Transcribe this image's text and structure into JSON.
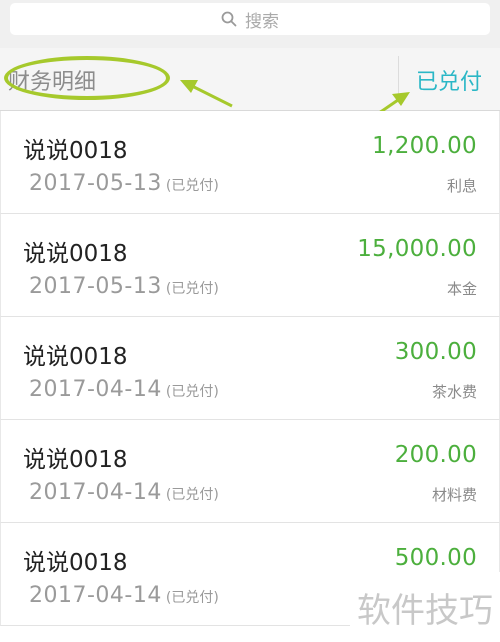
{
  "search": {
    "placeholder": "搜索",
    "icon": "search-icon"
  },
  "filter": {
    "title": "财务明细",
    "status": "已兑付",
    "highlight_color": "#a6c92c",
    "status_color": "#2ab7c6"
  },
  "records": [
    {
      "name": "说说0018",
      "date": "2017-05-13",
      "status": "(已兑付)",
      "amount": "1,200.00",
      "category": "利息"
    },
    {
      "name": "说说0018",
      "date": "2017-05-13",
      "status": "(已兑付)",
      "amount": "15,000.00",
      "category": "本金"
    },
    {
      "name": "说说0018",
      "date": "2017-04-14",
      "status": "(已兑付)",
      "amount": "300.00",
      "category": "茶水费"
    },
    {
      "name": "说说0018",
      "date": "2017-04-14",
      "status": "(已兑付)",
      "amount": "200.00",
      "category": "材料费"
    },
    {
      "name": "说说0018",
      "date": "2017-04-14",
      "status": "(已兑付)",
      "amount": "500.00",
      "category": ""
    }
  ],
  "watermark": "软件技巧",
  "colors": {
    "amount": "#4caf3d",
    "accent": "#2ab7c6",
    "annotation": "#a6c92c"
  }
}
